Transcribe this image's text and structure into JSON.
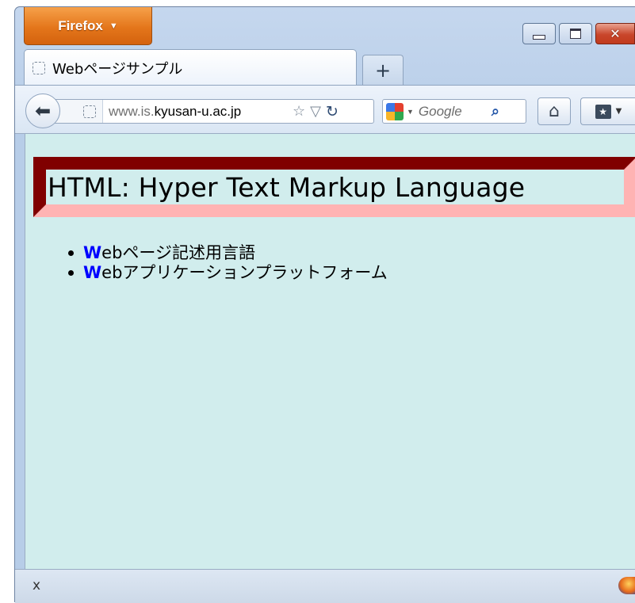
{
  "browser": {
    "menu_button_label": "Firefox",
    "menu_caret": "▼",
    "window_controls": {
      "minimize_icon": "minimize-icon",
      "maximize_icon": "maximize-icon",
      "close_glyph": "✕"
    }
  },
  "tabs": [
    {
      "label": "Webページサンプル",
      "icon": "dashed-page-icon",
      "active": true
    }
  ],
  "new_tab_label": "+",
  "navbar": {
    "back_glyph": "🡐",
    "url_prefix": "www.is.",
    "url_domain": "kyusan-u.ac.jp",
    "bookmark_star": "☆",
    "history_dropdown": "▽",
    "reload_glyph": "C",
    "search_placeholder": "Google",
    "search_engine_caret": "▼",
    "search_go_glyph": "ρ",
    "home_glyph": "🏠",
    "bookmarks_caret": "▼"
  },
  "page": {
    "heading": "HTML: Hyper Text Markup Language",
    "list_items": [
      {
        "first_letter": "W",
        "rest": "ebページ記述用言語"
      },
      {
        "first_letter": "W",
        "rest": "ebアプリケーションプラットフォーム"
      }
    ],
    "colors": {
      "background": "#d1eded",
      "heading_border_dark": "#800000",
      "heading_border_light": "#ffb3b3",
      "first_letter": "#0000ff"
    }
  },
  "statusbar": {
    "close_glyph": "x"
  }
}
